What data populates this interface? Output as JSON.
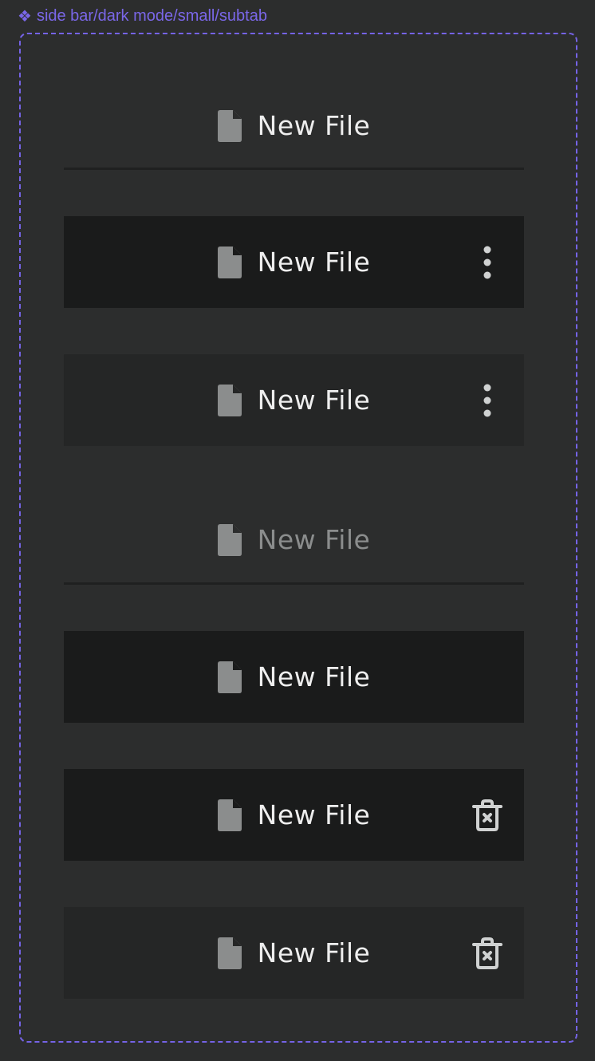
{
  "component_label": "side bar/dark mode/small/subtab",
  "colors": {
    "accent": "#7563e6",
    "background": "#2c2d2d",
    "selected_row": "#1a1b1b",
    "hover_row": "#252626",
    "text": "#eeeeee",
    "disabled_text": "#8b8d8d",
    "icon": "#8b8d8d",
    "action_icon": "#d0d2d2"
  },
  "rows": [
    {
      "label": "New File",
      "icon": "file-icon",
      "state": "default",
      "action": null
    },
    {
      "label": "New File",
      "icon": "file-icon",
      "state": "selected",
      "action": "more-vertical-icon"
    },
    {
      "label": "New File",
      "icon": "file-icon",
      "state": "hover",
      "action": "more-vertical-icon"
    },
    {
      "label": "New File",
      "icon": "file-icon",
      "state": "disabled",
      "action": null
    },
    {
      "label": "New File",
      "icon": "file-icon",
      "state": "selected",
      "action": null
    },
    {
      "label": "New File",
      "icon": "file-icon",
      "state": "selected",
      "action": "trash-x-icon"
    },
    {
      "label": "New File",
      "icon": "file-icon",
      "state": "hover",
      "action": "trash-x-icon"
    }
  ]
}
